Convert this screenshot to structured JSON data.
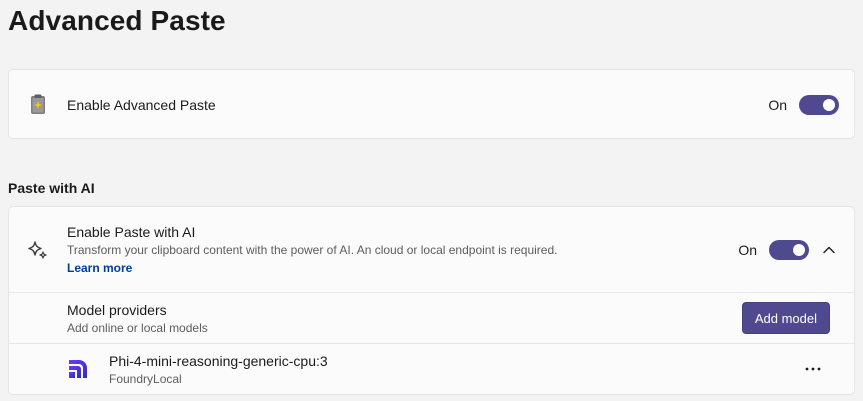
{
  "page": {
    "title": "Advanced Paste"
  },
  "enable_card": {
    "label": "Enable Advanced Paste",
    "toggle_state": "On",
    "icon": "advanced-paste-app-icon"
  },
  "section": {
    "title": "Paste with AI"
  },
  "ai_card": {
    "label": "Enable Paste with AI",
    "description": "Transform your clipboard content with the power of AI. An cloud or local endpoint is required.",
    "learn_more": "Learn more",
    "toggle_state": "On",
    "icon": "sparkle-icon",
    "expander_icon": "chevron-up-icon",
    "providers": {
      "label": "Model providers",
      "description": "Add online or local models",
      "add_button": "Add model"
    },
    "model": {
      "name": "Phi-4-mini-reasoning-generic-cpu:3",
      "provider": "FoundryLocal",
      "icon": "foundry-local-icon",
      "more_icon": "more-icon"
    }
  },
  "colors": {
    "accent": "#4f4a8f",
    "link": "#003e92",
    "background": "#f3f3f3",
    "card": "#fbfbfb"
  }
}
